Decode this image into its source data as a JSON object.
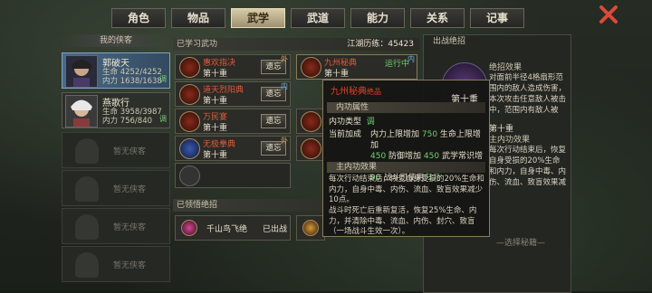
{
  "tabs": [
    {
      "label": "角色"
    },
    {
      "label": "物品"
    },
    {
      "label": "武学"
    },
    {
      "label": "武道"
    },
    {
      "label": "能力"
    },
    {
      "label": "关系"
    },
    {
      "label": "记事"
    }
  ],
  "left": {
    "title": "我的侠客",
    "heroes": [
      {
        "name": "郭破天",
        "hp": "生命 4252/4252",
        "mp": "内力 1638/1638",
        "tag": "调"
      },
      {
        "name": "燕歌行",
        "hp": "生命 3958/3987",
        "mp": "内力 756/840",
        "tag": "调"
      }
    ],
    "empty_label": "暂无侠客"
  },
  "center": {
    "learned_title": "已学习武功",
    "score": "江湖历练：45423",
    "skills": [
      {
        "name": "惠欢指决",
        "level": "第十重",
        "btn": "遗忘",
        "mark": "外"
      },
      {
        "name": "道天烈阳典",
        "level": "第十重",
        "btn": "遗忘",
        "mark": "内"
      },
      {
        "name": "万民宴",
        "level": "第十重",
        "btn": "遗忘",
        "mark": ""
      },
      {
        "name": "无极拳典",
        "level": "第十重",
        "btn": "遗忘",
        "mark": "外"
      }
    ],
    "right_skill": {
      "name": "九州秘典",
      "level": "第十重",
      "status": "运行中",
      "mark": "内"
    },
    "right_levels": [
      "第十重",
      "第十重",
      "第十重"
    ],
    "comprehend_title": "已领悟绝招",
    "ultimate": {
      "name": "千山鸟飞绝",
      "status": "已出战"
    }
  },
  "right": {
    "title": "出战绝招",
    "ult_effect_title": "绝招效果",
    "ult_effect_text": "对面前半径4格扇形范围内的敌人造成伤害，本次攻击任意敌人被击中，范围内有敌人被",
    "level": "第十重",
    "inner_title": "主内功效果",
    "inner_text": "每次行动结束后，恢复自身受损的20%生命和内力，自身中毒、内伤、流血、致盲效果减",
    "placeholder": "—选择秘籍—"
  },
  "tooltip": {
    "name": "九州秘典",
    "sub": "绝品",
    "level": "第十重",
    "attr_bar": "内功属性",
    "type_label": "内功类型",
    "type_value": "调",
    "bonus_label": "当前加成",
    "bonus_lines": [
      [
        "内力上限增加 ",
        "750",
        " 生命上限增加"
      ],
      [
        "450",
        " 防御增加 ",
        "450",
        " 武学常识增加"
      ],
      [
        "90",
        " 战斗可使用",
        "归元"
      ]
    ],
    "effect_bar": "主内功效果",
    "effect_text": "每次行动结束后，恢复自身受损的20%生命和内力，自身中毒、内伤、流血、致盲效果减少10点。",
    "revive_text": "战斗时死亡后重新复活，恢复25%生命、内力，并清除中毒、流血、内伤、封穴、致盲（一场战斗生效一次）。"
  }
}
